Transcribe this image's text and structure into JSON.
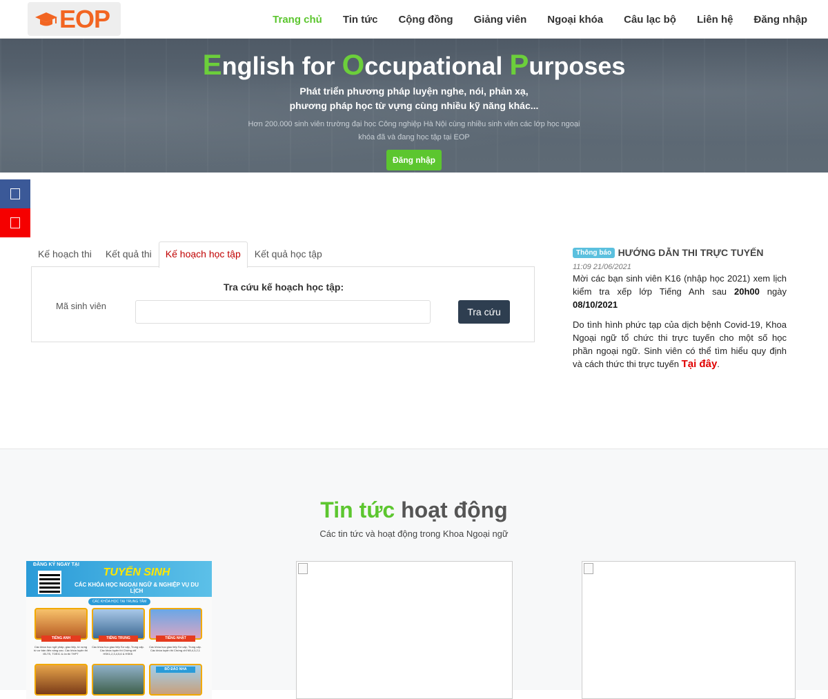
{
  "header": {
    "logo_text": "EOP",
    "nav": [
      {
        "label": "Trang chủ",
        "active": true
      },
      {
        "label": "Tin tức"
      },
      {
        "label": "Cộng đồng"
      },
      {
        "label": "Giảng viên"
      },
      {
        "label": "Ngoại khóa"
      },
      {
        "label": "Câu lạc bộ"
      },
      {
        "label": "Liên hệ"
      },
      {
        "label": "Đăng nhập"
      }
    ]
  },
  "hero": {
    "title_parts": [
      "E",
      "nglish for ",
      "O",
      "ccupational ",
      "P",
      "urposes"
    ],
    "subtitle_line1": "Phát triển phương pháp luyện nghe, nói, phản xạ,",
    "subtitle_line2": "phương pháp học từ vựng cùng nhiều kỹ năng khác...",
    "description_line1": "Hơn 200.000 sinh viên trường đại học Công nghiệp Hà Nội cùng nhiều sinh viên các lớp học ngoại",
    "description_line2": "khóa đã và đang học tập tại EOP",
    "login_button": "Đăng nhập"
  },
  "social": {
    "facebook_icon": "facebook-icon",
    "youtube_icon": "youtube-icon",
    "facebook_color": "#3b5998",
    "youtube_color": "#f50000"
  },
  "lookup": {
    "tabs": [
      "Kế hoạch thi",
      "Kết quả thi",
      "Kế hoạch học tập",
      "Kết quả học tập"
    ],
    "active_tab": 2,
    "panel_title": "Tra cứu kế hoạch học tập:",
    "student_id_label": "Mã sinh viên",
    "student_id_value": "",
    "search_button": "Tra cứu"
  },
  "notice": {
    "badge": "Thông báo",
    "title": "HƯỚNG DẪN THI TRỰC TUYẾN",
    "time": "11:09 21/06/2021",
    "p1_text": "Mời các bạn sinh viên K16 (nhập học 2021) xem lịch kiểm tra xếp lớp Tiếng Anh sau ",
    "p1_bold_time": "20h00",
    "p1_mid": " ngày ",
    "p1_bold_date": "08/10/2021",
    "p2_text": "Do tình hình phức tạp của dịch bệnh Covid-19, Khoa Ngoại ngữ tổ chức thi trực tuyến cho một số học phần ngoại ngữ. Sinh viên có thể tìm hiểu quy định và cách thức thi trực tuyến ",
    "p2_link": "Tại đây",
    "p2_end": "."
  },
  "news": {
    "title_green": "Tin tức",
    "title_rest": " hoạt động",
    "subtitle": "Các tin tức và hoạt động trong Khoa Ngoại ngữ",
    "poster": {
      "tag": "ĐĂNG KÝ NGAY TẠI",
      "heading": "TUYỂN SINH",
      "subheading": "CÁC KHÓA HỌC NGOẠI NGỮ & NGHIỆP VỤ DU LỊCH",
      "category": "CÁC KHÓA HỌC TẠI TRUNG TÂM",
      "tiles": [
        "TIẾNG ANH",
        "TIẾNG TRUNG",
        "TIẾNG NHẬT"
      ],
      "descs": [
        "Các khóa học ngữ pháp, giao tiếp, từ vựng từ cơ bản đến nâng cao. Các khóa luyện thi IELTS, TOEIC & ôn thi THPT",
        "Các khóa học giao tiếp Sơ cấp, Trung cấp. Các khóa luyện thi Chứng chỉ HSK1,2,3,4,5,6 & HSKK",
        "Các khóa học giao tiếp Sơ cấp, Trung cấp. Các khóa luyện thi Chứng chỉ N5,4,3,2,1"
      ],
      "tiles_row2": [
        "",
        "",
        "BỒ ĐÀO NHA"
      ]
    }
  }
}
